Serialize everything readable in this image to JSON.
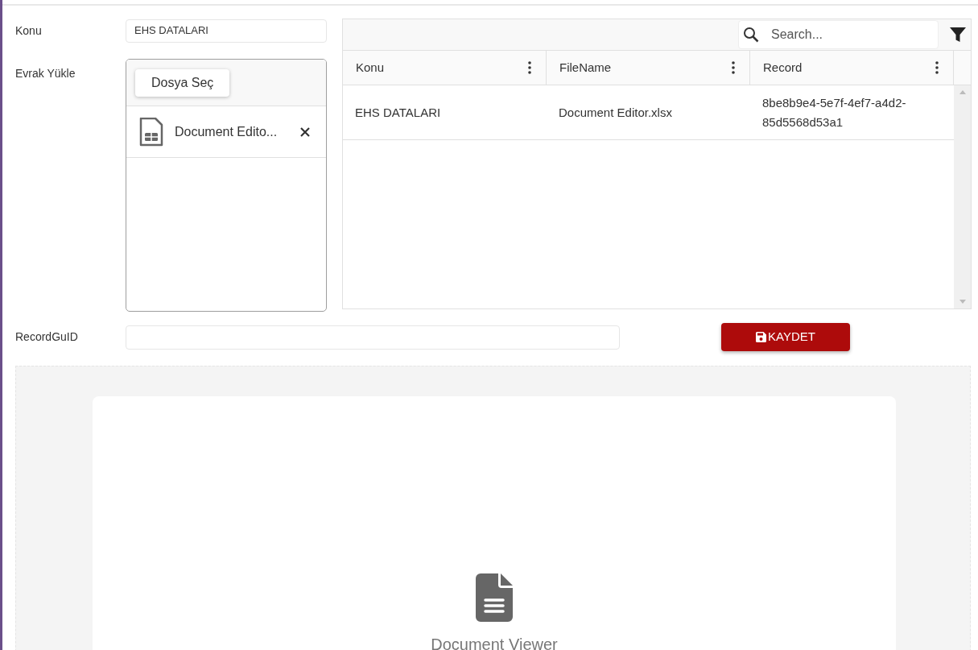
{
  "form": {
    "konu_label": "Konu",
    "konu_value": "EHS DATALARI",
    "upload_label": "Evrak Yükle",
    "upload_button": "Dosya Seç",
    "files": [
      {
        "name": "Document Edito..."
      }
    ],
    "guid_label": "RecordGuID",
    "save_button": "KAYDET"
  },
  "grid": {
    "search_placeholder": "Search...",
    "columns": [
      "Konu",
      "FileName",
      "Record"
    ],
    "rows": [
      [
        "EHS DATALARI",
        "Document Editor.xlsx",
        "8be8b9e4-5e7f-4ef7-a4d2-85d5568d53a1"
      ]
    ]
  },
  "viewer": {
    "title": "Document Viewer"
  }
}
